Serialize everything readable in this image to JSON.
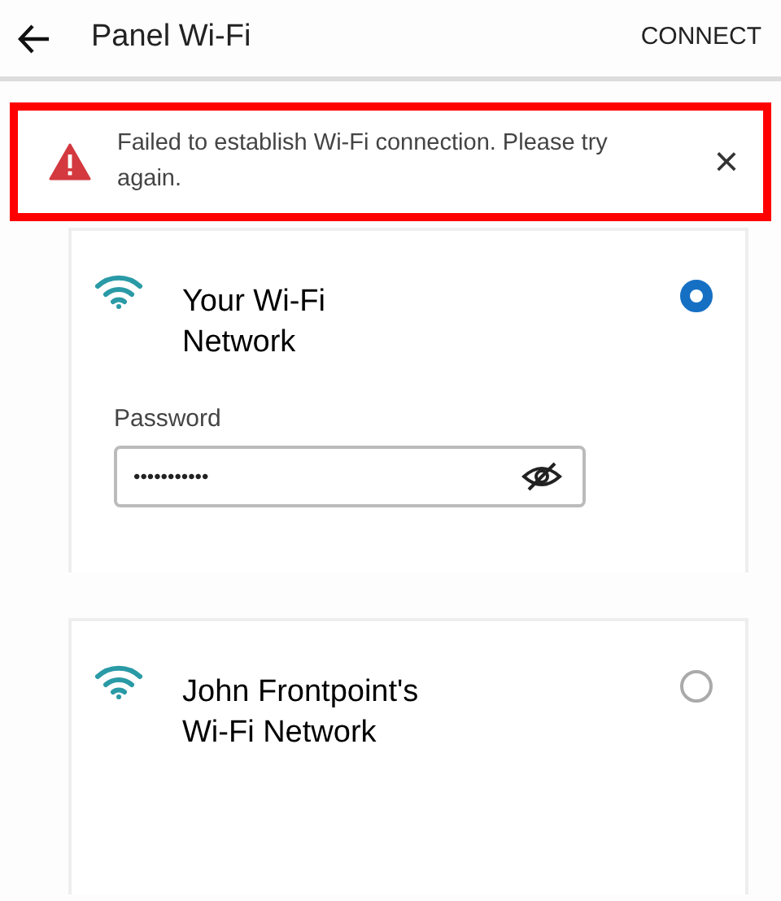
{
  "header": {
    "title": "Panel Wi-Fi",
    "action": "CONNECT"
  },
  "alert": {
    "message": "Failed to establish Wi-Fi connection. Please try again.",
    "close": "×",
    "highlighted": true
  },
  "networks": [
    {
      "name": "Your Wi-Fi Network",
      "selected": true,
      "password": {
        "label": "Password",
        "value": "•••••••••••"
      }
    },
    {
      "name": "John Frontpoint's Wi-Fi Network",
      "selected": false
    }
  ]
}
